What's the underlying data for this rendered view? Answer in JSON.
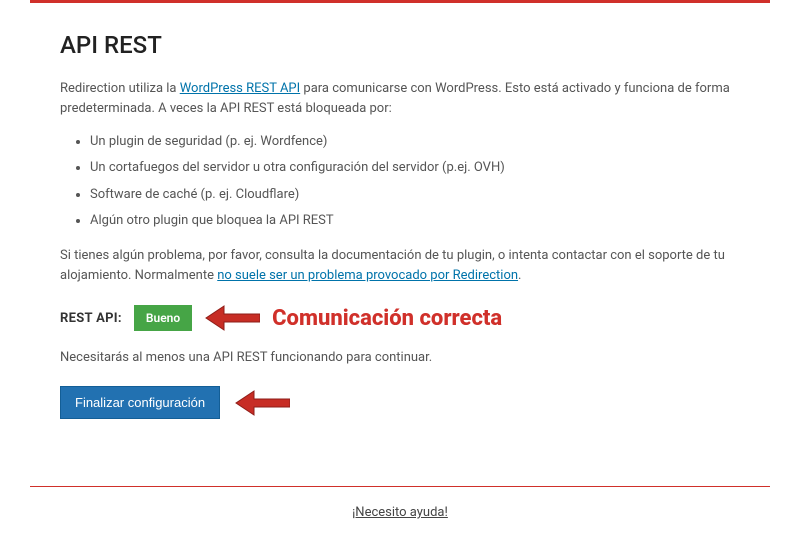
{
  "heading": "API REST",
  "intro_before_link": "Redirection utiliza la ",
  "intro_link": "WordPress REST API",
  "intro_after_link": " para comunicarse con WordPress. Esto está activado y funciona de forma predeterminada. A veces la API REST está bloqueada por:",
  "bullets": [
    "Un plugin de seguridad (p. ej. Wordfence)",
    "Un cortafuegos del servidor u otra configuración del servidor (p.ej. OVH)",
    "Software de caché (p. ej. Cloudflare)",
    "Algún otro plugin que bloquea la API REST"
  ],
  "para2_before_link": "Si tienes algún problema, por favor, consulta la documentación de tu plugin, o intenta contactar con el soporte de tu alojamiento. Normalmente ",
  "para2_link": "no suele ser un problema provocado por Redirection",
  "para2_after_link": ".",
  "status": {
    "label": "REST API:",
    "value": "Bueno"
  },
  "annotation": "Comunicación correcta",
  "note": "Necesitarás al menos una API REST funcionando para continuar.",
  "button": "Finalizar configuración",
  "help": "¡Necesito ayuda!"
}
